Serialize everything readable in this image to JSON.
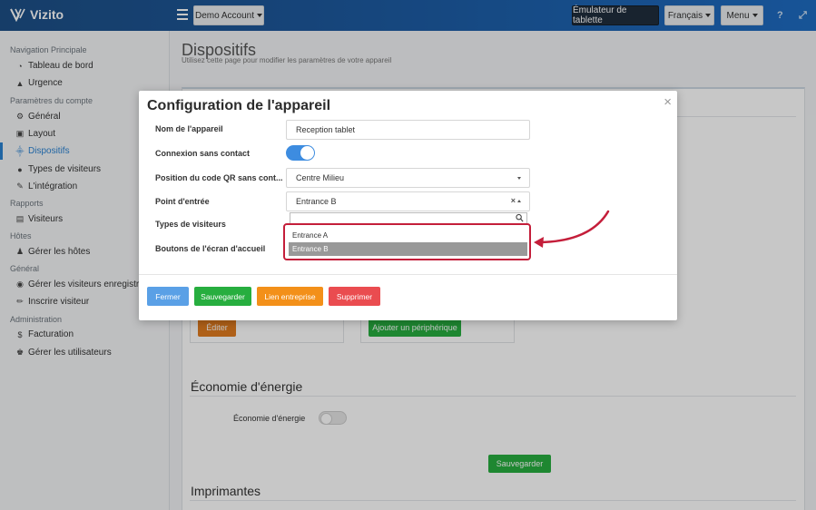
{
  "app": {
    "name": "Vizito"
  },
  "topbar": {
    "account_label": "Demo Account",
    "emulator_label": "Émulateur de tablette",
    "language_label": "Français",
    "menu_label": "Menu",
    "help_icon": "?"
  },
  "sidebar": {
    "sections": {
      "nav": "Navigation Principale",
      "account": "Paramètres du compte",
      "reports": "Rapports",
      "hosts": "Hôtes",
      "general": "Général",
      "admin": "Administration"
    },
    "items": [
      {
        "label": "Tableau de bord",
        "icon": "dashboard-icon"
      },
      {
        "label": "Urgence",
        "icon": "warning-icon"
      },
      {
        "label": "Général",
        "icon": "gear-icon"
      },
      {
        "label": "Layout",
        "icon": "image-icon"
      },
      {
        "label": "Dispositifs",
        "icon": "sitemap-icon"
      },
      {
        "label": "Types de visiteurs",
        "icon": "users-icon"
      },
      {
        "label": "L'intégration",
        "icon": "plug-icon"
      },
      {
        "label": "Visiteurs",
        "icon": "book-icon"
      },
      {
        "label": "Gérer les hôtes",
        "icon": "person-icon"
      },
      {
        "label": "Gérer les visiteurs enregistrés",
        "icon": "badge-icon"
      },
      {
        "label": "Inscrire visiteur",
        "icon": "pencil-icon"
      },
      {
        "label": "Facturation",
        "icon": "dollar-icon"
      },
      {
        "label": "Gérer les utilisateurs",
        "icon": "user-cog-icon"
      }
    ]
  },
  "page": {
    "title": "Dispositifs",
    "subtitle": "Utilisez cette page pour modifier les paramètres de votre appareil"
  },
  "background": {
    "edit_button": "Éditer",
    "add_device_button": "Ajouter un périphérique",
    "energy_title": "Économie d'énergie",
    "energy_label": "Économie d'énergie",
    "save_button": "Sauvegarder",
    "printers_title": "Imprimantes"
  },
  "modal": {
    "title": "Configuration de l'appareil",
    "close": "×",
    "fields": {
      "device_name_label": "Nom de l'appareil",
      "device_name_value": "Reception tablet",
      "contactless_label": "Connexion sans contact",
      "qr_position_label": "Position du code QR sans cont...",
      "qr_position_value": "Centre Milieu",
      "entry_point_label": "Point d'entrée",
      "entry_point_value": "Entrance B",
      "visitor_types_label": "Types de visiteurs",
      "home_buttons_label": "Boutons de l'écran d'accueil"
    },
    "entry_options": [
      "Entrance A",
      "Entrance B"
    ],
    "buttons": {
      "close": "Fermer",
      "save": "Sauvegarder",
      "company_link": "Lien entreprise",
      "delete": "Supprimer"
    }
  },
  "colors": {
    "accent": "#2a82d1",
    "highlight": "#c41e3a",
    "btn_blue": "#5aa0e6",
    "btn_green": "#27ae3f",
    "btn_orange": "#f39019",
    "btn_red": "#ea4c50"
  }
}
